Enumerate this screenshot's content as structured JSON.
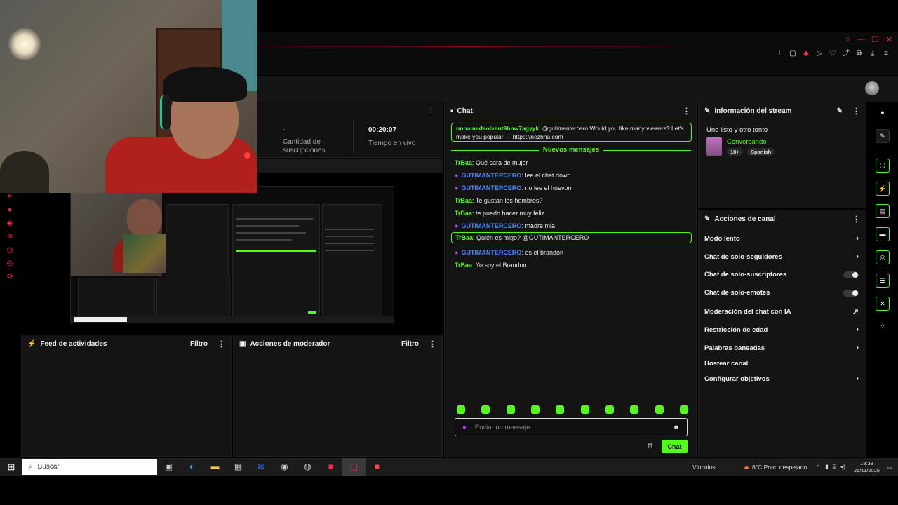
{
  "colors": {
    "accent": "#53fc18",
    "brand_red": "#ff2a4d",
    "mod_blue": "#4f8cff",
    "mic_purple": "#b040ff"
  },
  "stats": {
    "subs_value": "-",
    "subs_label": "Cantidad de suscripciones",
    "live_value": "00:20:07",
    "live_label": "Tiempo en vivo"
  },
  "panels": {
    "feed": {
      "title": "Feed de actividades",
      "filter": "Filtro"
    },
    "mod": {
      "title": "Acciones de moderador",
      "filter": "Filtro"
    }
  },
  "chat": {
    "title": "Chat",
    "pinned": {
      "user": "unnamedsolvent9hnw7agyyk",
      "text": ": @gutimantercero Would you like many viewers? Let's make you popular — https://nezhna.com"
    },
    "new_messages": "Nuevos mensajes",
    "messages": [
      {
        "user": "TrBaa",
        "text": ": Qué cara de mujer",
        "mod": false
      },
      {
        "user": "GUTIMANTERCERO",
        "text": ": lee el chat down",
        "mod": true
      },
      {
        "user": "GUTIMANTERCERO",
        "text": ": no lee el huevon",
        "mod": true
      },
      {
        "user": "TrBaa",
        "text": ": Te gustan los hombres?",
        "mod": false
      },
      {
        "user": "TrBaa",
        "text": ": te puedo hacer muy feliz",
        "mod": false
      },
      {
        "user": "GUTIMANTERCERO",
        "text": ": madre mia",
        "mod": true
      },
      {
        "user": "TrBaa",
        "text": ": Quién es migo? @GUTIMANTERCERO",
        "mod": false
      },
      {
        "user": "GUTIMANTERCERO",
        "text": ": es el brandon",
        "mod": true
      },
      {
        "user": "TrBaa",
        "text": ": Yo soy el Brandon",
        "mod": false
      }
    ],
    "input_placeholder": "Enviar un mensaje",
    "send_label": "Chat"
  },
  "stream_info": {
    "title": "Información del stream",
    "stream_title": "Uno listo y otro tonto",
    "category": "Conversando",
    "tags": [
      "18+",
      "Spanish"
    ]
  },
  "channel_actions": {
    "title": "Acciones de canal",
    "items": [
      {
        "label": "Modo lento",
        "control": "chevron"
      },
      {
        "label": "Chat de solo-seguidores",
        "control": "chevron"
      },
      {
        "label": "Chat de solo-suscriptores",
        "control": "toggle"
      },
      {
        "label": "Chat de solo-emotes",
        "control": "toggle"
      },
      {
        "label": "Moderación del chat con IA",
        "control": "external"
      },
      {
        "label": "Restricción de edad",
        "control": "chevron"
      },
      {
        "label": "Palabras baneadas",
        "control": "chevron"
      },
      {
        "label": "Hostear canal",
        "control": "none"
      },
      {
        "label": "Configurar objetivos",
        "control": "chevron"
      }
    ]
  },
  "taskbar": {
    "search_placeholder": "Buscar",
    "links": "Vínculos",
    "weather": "8°C  Prac. despejado",
    "time": "18:33",
    "date": "25/11/2025"
  }
}
